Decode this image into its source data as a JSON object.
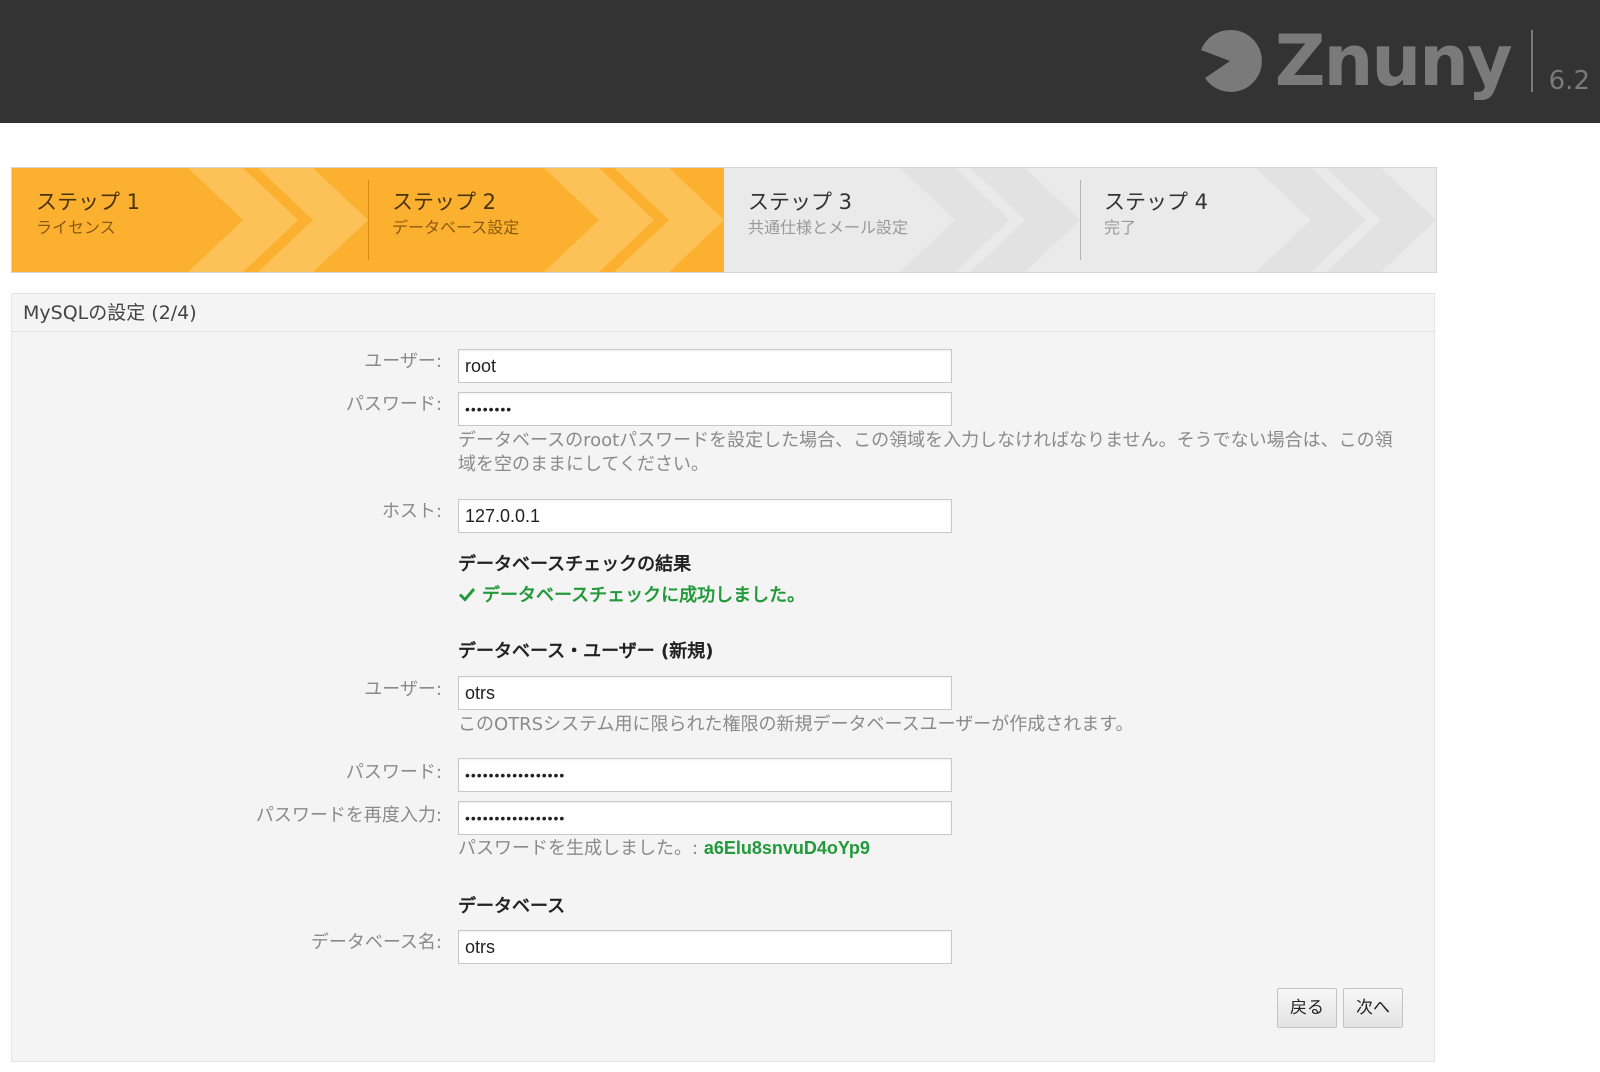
{
  "header": {
    "brand_name": "Znuny",
    "version": "6.2",
    "logo_icon": "znuny-logo-icon"
  },
  "steps": [
    {
      "title": "ステップ 1",
      "subtitle": "ライセンス",
      "state": "done"
    },
    {
      "title": "ステップ 2",
      "subtitle": "データベース設定",
      "state": "current"
    },
    {
      "title": "ステップ 3",
      "subtitle": "共通仕様とメール設定",
      "state": "pending"
    },
    {
      "title": "ステップ 4",
      "subtitle": "完了",
      "state": "pending"
    }
  ],
  "colors": {
    "header_bg": "#333333",
    "step_active": "#fbb12f",
    "step_inactive": "#eaeaea",
    "success_green": "#239a3a"
  },
  "panel": {
    "title": "MySQLの設定 (2/4)",
    "admin": {
      "user_label": "ユーザー:",
      "user_value": "root",
      "password_label": "パスワード:",
      "password_value": "••••••••",
      "password_hint": "データベースのrootパスワードを設定した場合、この領域を入力しなければなりません。そうでない場合は、この領域を空のままにしてください。",
      "host_label": "ホスト:",
      "host_value": "127.0.0.1"
    },
    "check": {
      "heading": "データベースチェックの結果",
      "icon": "checkmark-icon",
      "result": "データベースチェックに成功しました。"
    },
    "new_user": {
      "heading": "データベース・ユーザー (新規)",
      "user_label": "ユーザー:",
      "user_value": "otrs",
      "user_hint": "このOTRSシステム用に限られた権限の新規データベースユーザーが作成されます。",
      "password_label": "パスワード:",
      "password_value": "•••••••••••••••••",
      "password_repeat_label": "パスワードを再度入力:",
      "password_repeat_value": "•••••••••••••••••",
      "generated_prefix": "パスワードを生成しました。:",
      "generated_password": "a6Elu8snvuD4oYp9"
    },
    "database": {
      "heading": "データベース",
      "name_label": "データベース名:",
      "name_value": "otrs"
    },
    "buttons": {
      "back": "戻る",
      "next": "次へ"
    }
  }
}
